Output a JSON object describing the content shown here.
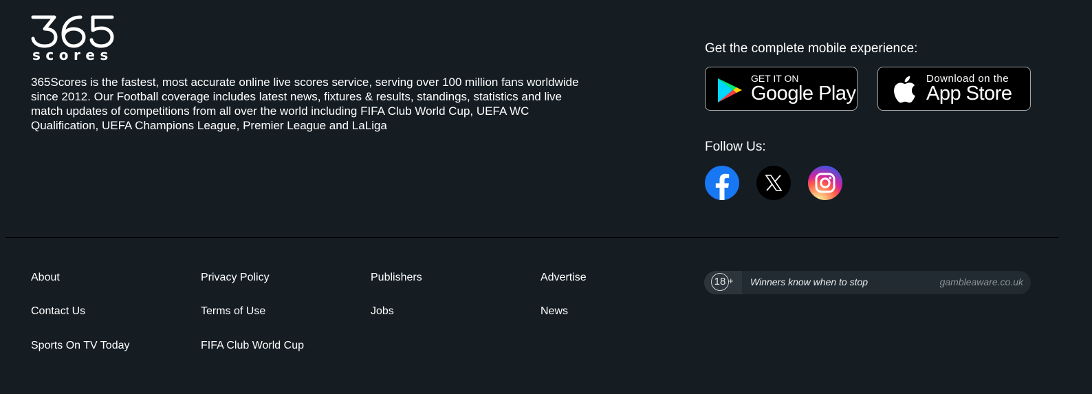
{
  "brand": {
    "logo_number": "365",
    "logo_word": "scores"
  },
  "description": "365Scores is the fastest, most accurate online live scores service, serving over 100 million fans worldwide since 2012. Our Football coverage includes latest news, fixtures & results, standings, statistics and live match updates of competitions from all over the world including FIFA Club World Cup, UEFA WC Qualification, UEFA Champions League, Premier League and LaLiga",
  "mobile": {
    "title": "Get the complete mobile experience:",
    "google_play": {
      "small": "GET IT ON",
      "big": "Google Play",
      "icon": "google-play-icon"
    },
    "app_store": {
      "small": "Download on the",
      "big": "App Store",
      "icon": "apple-icon"
    }
  },
  "follow": {
    "title": "Follow Us:",
    "networks": [
      {
        "name": "facebook",
        "icon": "facebook-icon",
        "color": "#1877f2"
      },
      {
        "name": "x",
        "icon": "x-icon",
        "color": "#000000"
      },
      {
        "name": "instagram",
        "icon": "instagram-icon",
        "color": "#d6249f"
      }
    ]
  },
  "footer_links": {
    "col1": [
      "About",
      "Contact Us",
      "Sports On TV Today"
    ],
    "col2": [
      "Privacy Policy",
      "Terms of Use",
      "FIFA Club World Cup"
    ],
    "col3": [
      "Publishers",
      "Jobs"
    ],
    "col4": [
      "Advertise",
      "News"
    ]
  },
  "gamble": {
    "age": "18",
    "plus": "+",
    "slogan": "Winners know when to stop",
    "site": "gambleaware.co.uk"
  },
  "colors": {
    "background": "#151d23",
    "text": "#ffffff",
    "divider": "#000000"
  }
}
